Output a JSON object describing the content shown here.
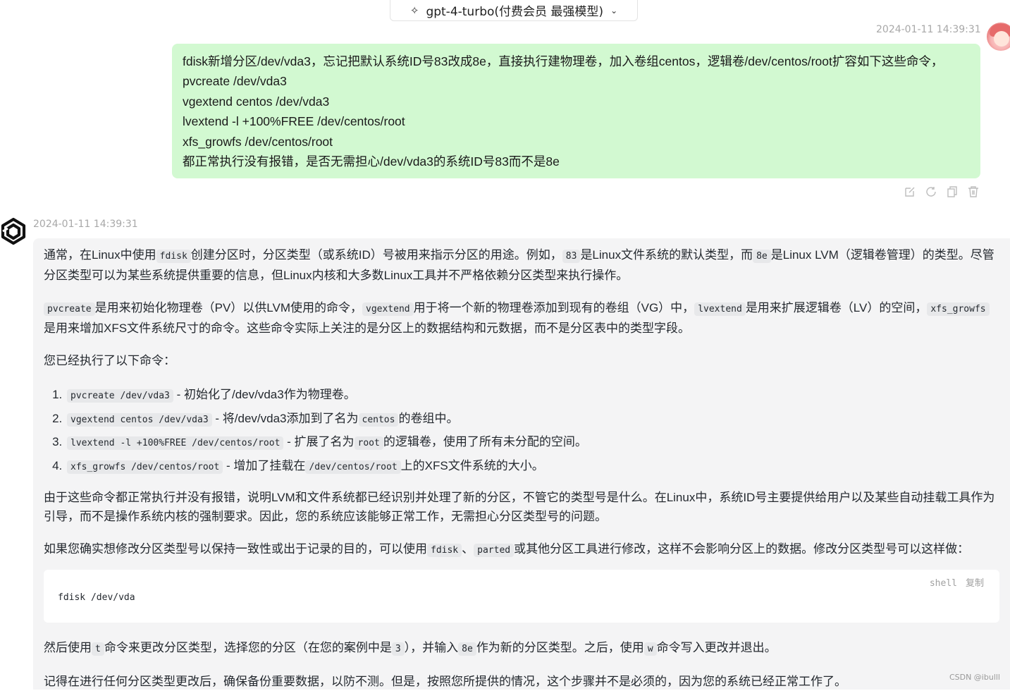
{
  "header": {
    "model_label": "gpt-4-turbo(付费会员 最强模型)"
  },
  "user_message": {
    "timestamp": "2024-01-11 14:39:31",
    "lines": [
      "fdisk新增分区/dev/vda3，忘记把默认系统ID号83改成8e，直接执行建物理卷，加入卷组centos，逻辑卷/dev/centos/root扩容如下这些命令，",
      "pvcreate /dev/vda3",
      "vgextend centos /dev/vda3",
      "lvextend -l +100%FREE /dev/centos/root",
      "xfs_growfs /dev/centos/root",
      "都正常执行没有报错，是否无需担心/dev/vda3的系统ID号83而不是8e"
    ],
    "actions": [
      "edit-icon",
      "refresh-icon",
      "copy-icon",
      "delete-icon"
    ]
  },
  "assistant_message": {
    "timestamp": "2024-01-11 14:39:31",
    "p1": {
      "a": "通常，在Linux中使用",
      "c1": "fdisk",
      "b": "创建分区时，分区类型（或系统ID）号被用来指示分区的用途。例如，",
      "c2": "83",
      "c": "是Linux文件系统的默认类型，而",
      "c3": "8e",
      "d": "是Linux LVM（逻辑卷管理）的类型。尽管分区类型可以为某些系统提供重要的信息，但Linux内核和大多数Linux工具并不严格依赖分区类型来执行操作。"
    },
    "p2": {
      "c1": "pvcreate",
      "a": "是用来初始化物理卷（PV）以供LVM使用的命令，",
      "c2": "vgextend",
      "b": "用于将一个新的物理卷添加到现有的卷组（VG）中，",
      "c3": "lvextend",
      "c": "是用来扩展逻辑卷（LV）的空间，",
      "c4": "xfs_growfs",
      "d": "是用来增加XFS文件系统尺寸的命令。这些命令实际上关注的是分区上的数据结构和元数据，而不是分区表中的类型字段。"
    },
    "p3": "您已经执行了以下命令：",
    "list": [
      {
        "code": "pvcreate /dev/vda3",
        "text": " - 初始化了/dev/vda3作为物理卷。",
        "code2": "",
        "text2": ""
      },
      {
        "code": "vgextend centos /dev/vda3",
        "text": " - 将/dev/vda3添加到了名为",
        "code2": "centos",
        "text2": "的卷组中。"
      },
      {
        "code": "lvextend -l +100%FREE /dev/centos/root",
        "text": " - 扩展了名为",
        "code2": "root",
        "text2": "的逻辑卷，使用了所有未分配的空间。"
      },
      {
        "code": "xfs_growfs /dev/centos/root",
        "text": " - 增加了挂载在",
        "code2": "/dev/centos/root",
        "text2": "上的XFS文件系统的大小。"
      }
    ],
    "p4": "由于这些命令都正常执行并没有报错，说明LVM和文件系统都已经识别并处理了新的分区，不管它的类型号是什么。在Linux中，系统ID号主要提供给用户以及某些自动挂载工具作为引导，而不是操作系统内核的强制要求。因此，您的系统应该能够正常工作，无需担心分区类型号的问题。",
    "p5": {
      "a": "如果您确实想修改分区类型号以保持一致性或出于记录的目的，可以使用",
      "c1": "fdisk",
      "b": "、",
      "c2": "parted",
      "c": "或其他分区工具进行修改，这样不会影响分区上的数据。修改分区类型号可以这样做："
    },
    "code_block": {
      "lang": "shell",
      "copy_label": "复制",
      "code": "fdisk /dev/vda"
    },
    "p6": {
      "a": "然后使用",
      "c1": "t",
      "b": "命令来更改分区类型，选择您的分区（在您的案例中是",
      "c2": "3",
      "c": "），并输入",
      "c3": "8e",
      "d": "作为新的分区类型。之后，使用",
      "c4": "w",
      "e": "命令写入更改并退出。"
    },
    "p7": "记得在进行任何分区类型更改后，确保备份重要数据，以防不测。但是，按照您所提供的情况，这个步骤并不是必须的，因为您的系统已经正常工作了。"
  },
  "watermark": "CSDN @ibulll"
}
